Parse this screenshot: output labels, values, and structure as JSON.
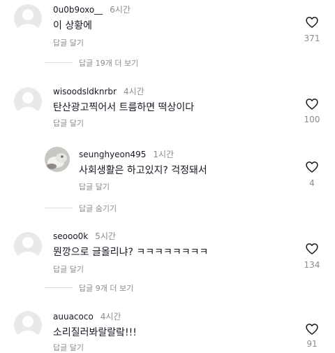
{
  "comments": [
    {
      "username": "0u0b9oxo__",
      "time": "6시간",
      "text": "이 상황에",
      "reply": "답글 달기",
      "likes": "371",
      "thread": "답글 19개 더 보기"
    },
    {
      "username": "wisoodsldknrbr",
      "time": "4시간",
      "text": "탄산광고찍어서 트름하면 떡상이다",
      "reply": "답글 달기",
      "likes": "100"
    },
    {
      "username": "seunghyeon495",
      "time": "1시간",
      "text": "사회생활은 하고있지? 걱정돼서",
      "reply": "답글 달기",
      "likes": "4",
      "thread": "답글 숨기기"
    },
    {
      "username": "seooo0k",
      "time": "5시간",
      "text": "뭔깡으로 글올리냐? ㅋㅋㅋㅋㅋㅋㅋㅋ",
      "reply": "답글 달기",
      "likes": "134",
      "thread": "답글 9개 더 보기"
    },
    {
      "username": "auuacoco",
      "time": "4시간",
      "text": "소리질러봐랄랄랔!!!",
      "reply": "답글 달기",
      "likes": "91"
    }
  ],
  "icons": {
    "like": "heart-outline-icon",
    "avatar": "default-avatar-icon",
    "photo": "profile-photo"
  },
  "colors": {
    "text": "#161823",
    "secondary": "#8a8b91",
    "avatar_bg": "#e9e9ea",
    "divider": "#d9d9dc"
  }
}
